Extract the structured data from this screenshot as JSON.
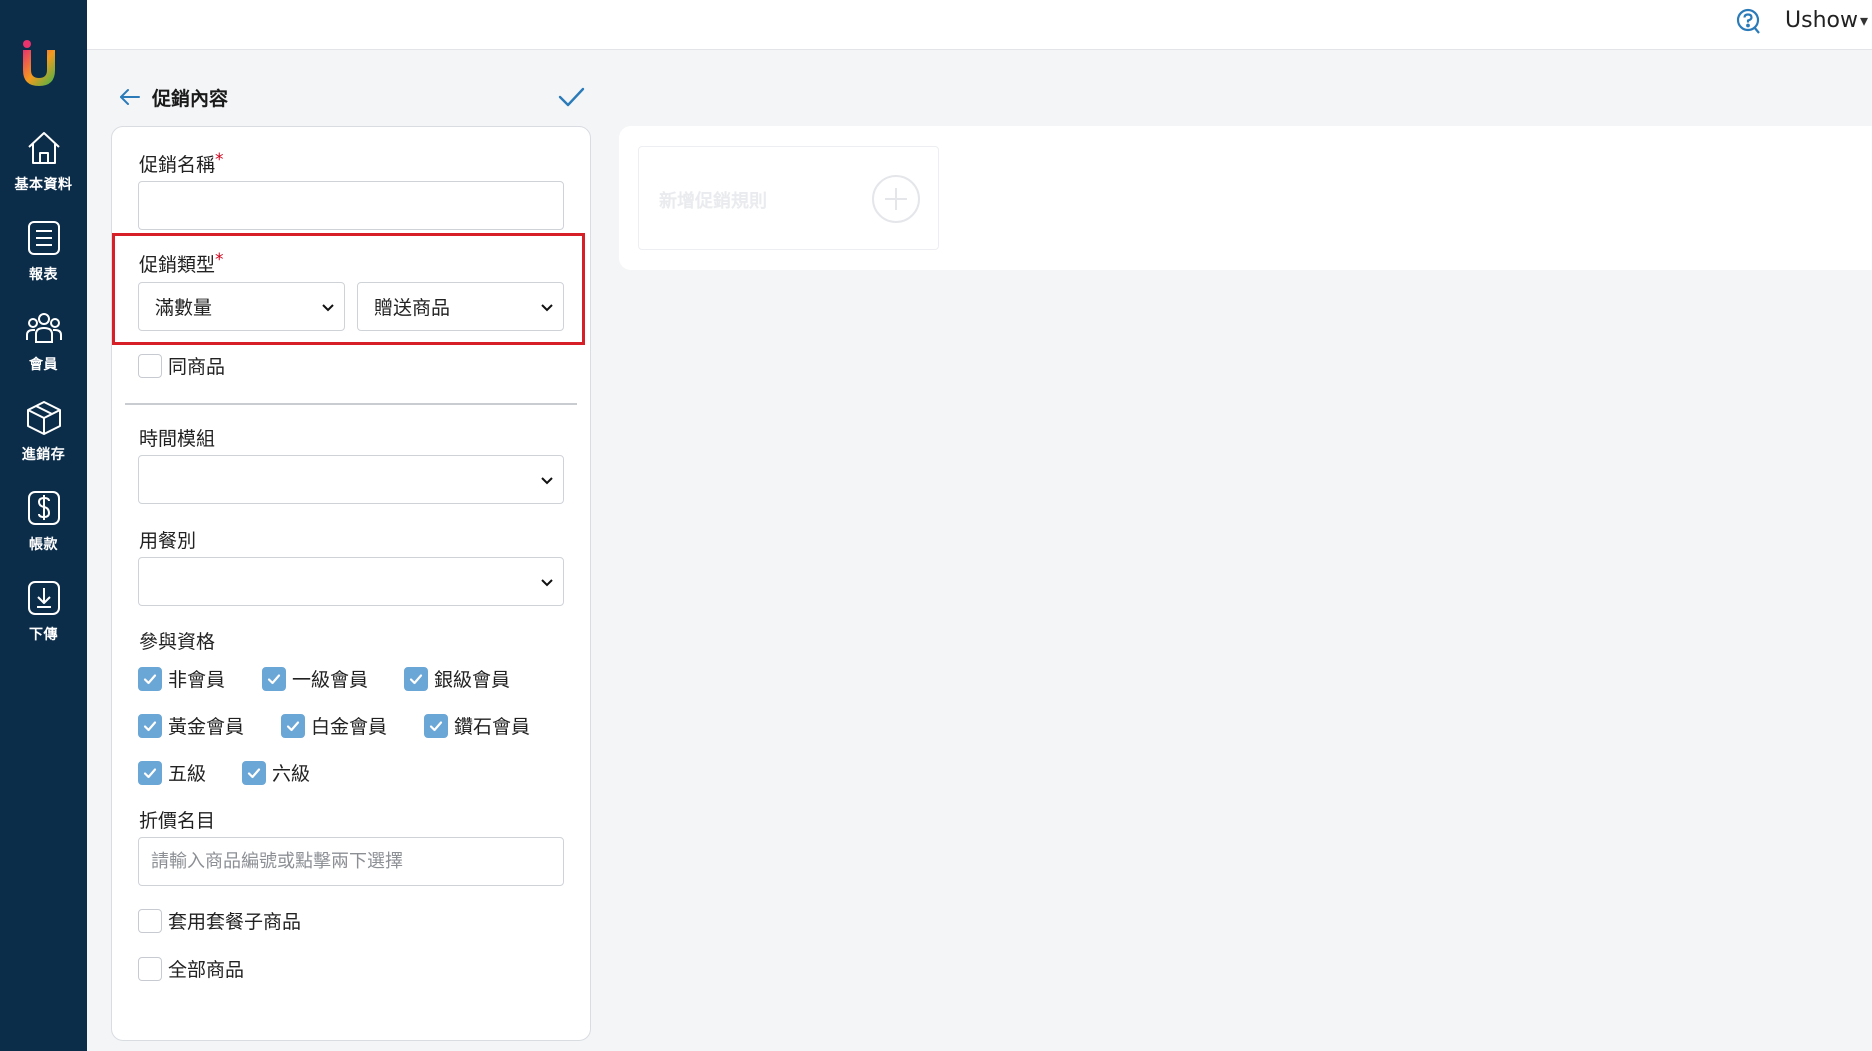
{
  "header": {
    "user_name": "Ushow",
    "user_caret": "▾"
  },
  "sidebar": {
    "items": [
      {
        "label": "基本資料",
        "icon": "home-icon"
      },
      {
        "label": "報表",
        "icon": "report-icon"
      },
      {
        "label": "會員",
        "icon": "members-icon"
      },
      {
        "label": "進銷存",
        "icon": "box-icon"
      },
      {
        "label": "帳款",
        "icon": "dollar-icon"
      },
      {
        "label": "下傳",
        "icon": "download-icon"
      }
    ]
  },
  "page": {
    "title": "促銷內容"
  },
  "form": {
    "promo_name_label": "促銷名稱",
    "required_mark": "*",
    "promo_name_value": "",
    "promo_type_label": "促銷類型",
    "promo_type_value": "滿數量",
    "promo_subtype_value": "贈送商品",
    "same_product_label": "同商品",
    "same_product_checked": false,
    "time_module_label": "時間模組",
    "time_module_value": "",
    "meal_type_label": "用餐別",
    "meal_type_value": "",
    "eligibility_label": "參與資格",
    "eligibility": [
      {
        "label": "非會員",
        "checked": true
      },
      {
        "label": "一級會員",
        "checked": true
      },
      {
        "label": "銀級會員",
        "checked": true
      },
      {
        "label": "黃金會員",
        "checked": true
      },
      {
        "label": "白金會員",
        "checked": true
      },
      {
        "label": "鑽石會員",
        "checked": true
      },
      {
        "label": "五級",
        "checked": true
      },
      {
        "label": "六級",
        "checked": true
      }
    ],
    "discount_items_label": "折價名目",
    "discount_items_placeholder": "請輸入商品編號或點擊兩下選擇",
    "apply_combo_label": "套用套餐子商品",
    "apply_combo_checked": false,
    "all_products_label": "全部商品",
    "all_products_checked": false
  },
  "rules": {
    "add_rule_label": "新增促銷規則"
  },
  "colors": {
    "sidebar_bg": "#0c2d4a",
    "accent": "#2b7bb9",
    "checkbox_checked": "#6aa6d6",
    "highlight": "#d61f26"
  }
}
